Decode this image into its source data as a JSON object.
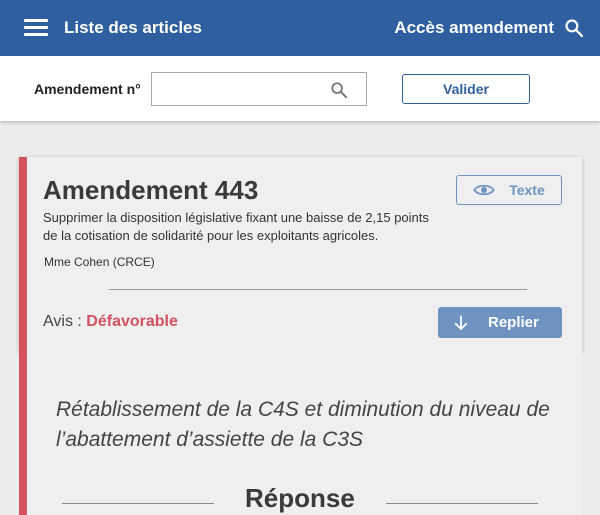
{
  "appbar": {
    "title": "Liste des articles",
    "action_label": "Accès amendement",
    "icons": {
      "menu": "menu-icon",
      "search": "search-icon"
    },
    "background_color": "#2f5f9f"
  },
  "search": {
    "label": "Amendement n°",
    "value": "",
    "placeholder": "",
    "submit_label": "Valider"
  },
  "amendment": {
    "title": "Amendement 443",
    "text_button_label": "Texte",
    "description": "Supprimer la disposition législative fixant une baisse de 2,15 points de la cotisation de solidarité pour les exploitants agricoles.",
    "author": "Mme Cohen (CRCE)",
    "avis_label": "Avis :",
    "avis_value": "Défavorable",
    "fold_button_label": "Replier",
    "accent_color": "#d4525f"
  },
  "answer": {
    "summary": "Rétablissement de la C4S et diminution du niveau de l’abattement d’assiette de la C3S",
    "heading": "Réponse"
  }
}
